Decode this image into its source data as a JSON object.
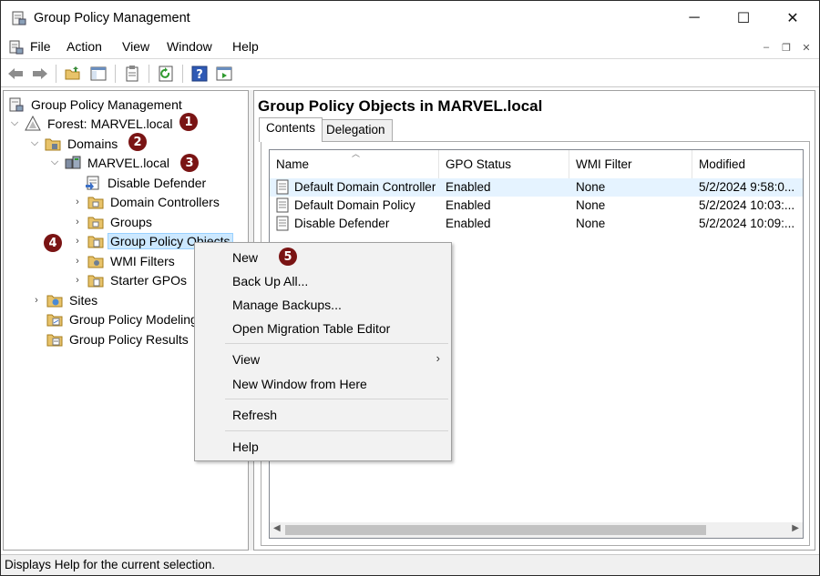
{
  "window": {
    "title": "Group Policy Management",
    "controls": {
      "minimize": "─",
      "maximize": "☐",
      "close": "✕"
    }
  },
  "menubar": {
    "items": [
      "File",
      "Action",
      "View",
      "Window",
      "Help"
    ],
    "mdi": {
      "minimize": "–",
      "restore": "❐",
      "close": "✕"
    }
  },
  "toolbar": {
    "buttons": [
      "back-icon",
      "forward-icon",
      "up-folder-icon",
      "show-hide-tree-icon",
      "properties-icon",
      "refresh-icon",
      "help-icon",
      "action-pane-icon"
    ]
  },
  "tree": {
    "root": "Group Policy Management",
    "forest": "Forest: MARVEL.local",
    "domains": "Domains",
    "domain": "MARVEL.local",
    "disable_defender": "Disable Defender",
    "domain_controllers": "Domain Controllers",
    "groups": "Groups",
    "gpo": "Group Policy Objects",
    "wmi_filters": "WMI Filters",
    "starter_gpos": "Starter GPOs",
    "sites": "Sites",
    "modeling": "Group Policy Modeling",
    "results": "Group Policy Results"
  },
  "badges": {
    "b1": "1",
    "b2": "2",
    "b3": "3",
    "b4": "4",
    "b5": "5"
  },
  "right_pane": {
    "title": "Group Policy Objects in MARVEL.local",
    "tabs": [
      "Contents",
      "Delegation"
    ],
    "columns": [
      "Name",
      "GPO Status",
      "WMI Filter",
      "Modified"
    ],
    "rows": [
      {
        "name": "Default Domain Controller...",
        "status": "Enabled",
        "wmi": "None",
        "modified": "5/2/2024 9:58:0..."
      },
      {
        "name": "Default Domain Policy",
        "status": "Enabled",
        "wmi": "None",
        "modified": "5/2/2024 10:03:..."
      },
      {
        "name": "Disable Defender",
        "status": "Enabled",
        "wmi": "None",
        "modified": "5/2/2024 10:09:..."
      }
    ]
  },
  "context_menu": {
    "new": "New",
    "back_up_all": "Back Up All...",
    "manage_backups": "Manage Backups...",
    "migration_table": "Open Migration Table Editor",
    "view": "View",
    "new_window": "New Window from Here",
    "refresh": "Refresh",
    "help": "Help"
  },
  "statusbar": {
    "text": "Displays Help for the current selection."
  },
  "colors": {
    "badge": "#7a1414",
    "selection": "#cce8ff",
    "row_hover": "#e5f3ff"
  }
}
